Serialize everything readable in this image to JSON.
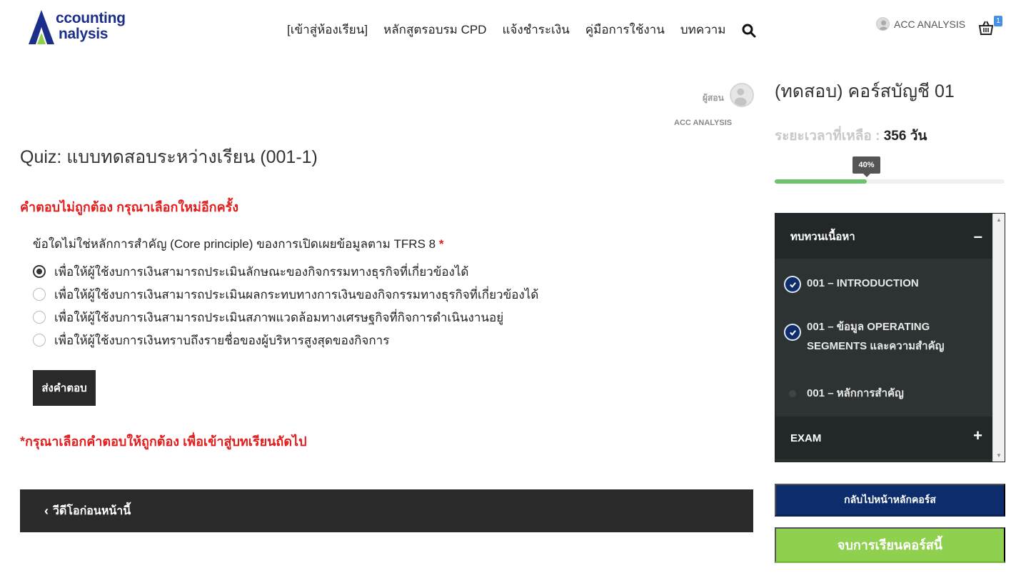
{
  "brand": {
    "logo_line1": "ccounting",
    "logo_line2": "nalysis",
    "colors": {
      "logo_blue": "#1b2f8a",
      "logo_green": "#8fd14f"
    }
  },
  "nav": {
    "items": [
      {
        "label": "[เข้าสู่ห้องเรียน]"
      },
      {
        "label": "หลักสูตรอบรม CPD"
      },
      {
        "label": "แจ้งชำระเงิน"
      },
      {
        "label": "คู่มือการใช้งาน"
      },
      {
        "label": "บทความ"
      }
    ],
    "search_icon": "search-icon"
  },
  "user": {
    "name": "ACC ANALYSIS",
    "avatar_icon": "user-avatar-icon"
  },
  "cart": {
    "icon": "basket-icon",
    "count": "1"
  },
  "instructor": {
    "label": "ผู้สอน",
    "name": "ACC ANALYSIS"
  },
  "quiz": {
    "title": "Quiz: แบบทดสอบระหว่างเรียน (001-1)",
    "error": "คำตอบไม่ถูกต้อง กรุณาเลือกใหม่อีกครั้ง",
    "question": "ข้อใดไม่ใช่หลักการสำคัญ (Core principle) ของการเปิดเผยข้อมูลตาม TFRS 8",
    "required_mark": "*",
    "options": [
      {
        "label": "เพื่อให้ผู้ใช้งบการเงินสามารถประเมินลักษณะของกิจกรรมทางธุรกิจที่เกี่ยวข้องได้",
        "selected": true
      },
      {
        "label": "เพื่อให้ผู้ใช้งบการเงินสามารถประเมินผลกระทบทางการเงินของกิจกรรมทางธุรกิจที่เกี่ยวข้องได้",
        "selected": false
      },
      {
        "label": "เพื่อให้ผู้ใช้งบการเงินสามารถประเมินสภาพแวดล้อมทางเศรษฐกิจที่กิจการดำเนินงานอยู่",
        "selected": false
      },
      {
        "label": "เพื่อให้ผู้ใช้งบการเงินทราบถึงรายชื่อของผู้บริหารสูงสุดของกิจการ",
        "selected": false
      }
    ],
    "submit_label": "ส่งคำตอบ",
    "note": "*กรุณาเลือกคำตอบให้ถูกต้อง เพื่อเข้าสู่บทเรียนถัดไป",
    "prev_label": "วีดีโอก่อนหน้านี้"
  },
  "course": {
    "title": "(ทดสอบ) คอร์สบัญชี 01",
    "remaining_label": "ระยะเวลาที่เหลือ :",
    "remaining_value": "356 วัน",
    "progress_label": "40%",
    "progress_fraction": 0.4,
    "colors": {
      "progress": "#6cc36c",
      "back_btn": "#0c2c6b",
      "finish_btn": "#8fd14f"
    }
  },
  "curriculum": {
    "section_title": "ทบทวนเนื้อหา",
    "section_toggle": "–",
    "lessons": [
      {
        "label": "001 – INTRODUCTION",
        "completed": true
      },
      {
        "label": "001 – ข้อมูล OPERATING SEGMENTS และความสำคัญ",
        "completed": true
      },
      {
        "label": "001 – หลักการสำคัญ",
        "completed": false
      }
    ],
    "exam_title": "EXAM",
    "exam_toggle": "+"
  },
  "actions": {
    "back_label": "กลับไปหน้าหลักคอร์ส",
    "finish_label": "จบการเรียนคอร์สนี้"
  }
}
